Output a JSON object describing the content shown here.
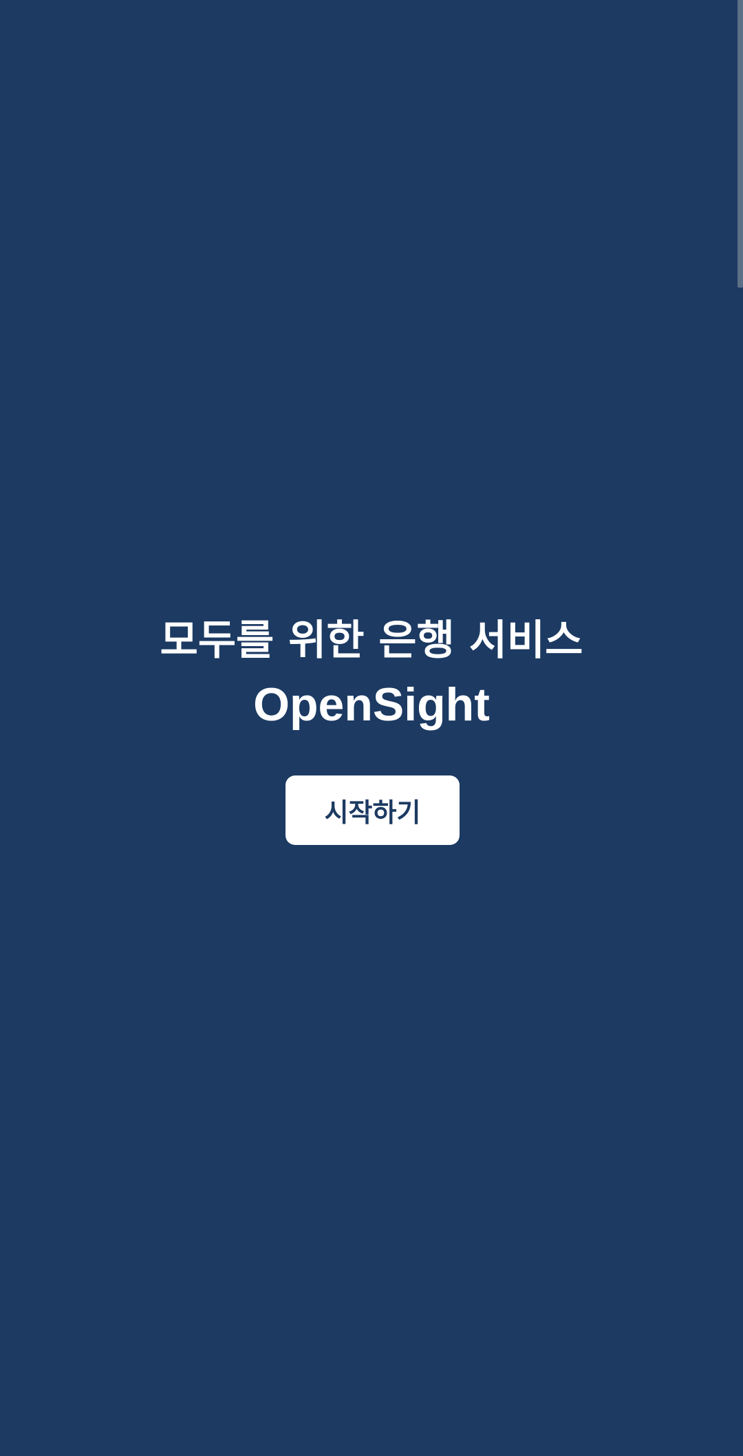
{
  "screen": {
    "background_color": "#1c3a62",
    "headline": "모두를 위한 은행 서비스",
    "brand_name": "OpenSight",
    "start_button_label": "시작하기",
    "text_color": "#ffffff",
    "button_background_color": "#ffffff",
    "button_text_color": "#1c3a62"
  }
}
